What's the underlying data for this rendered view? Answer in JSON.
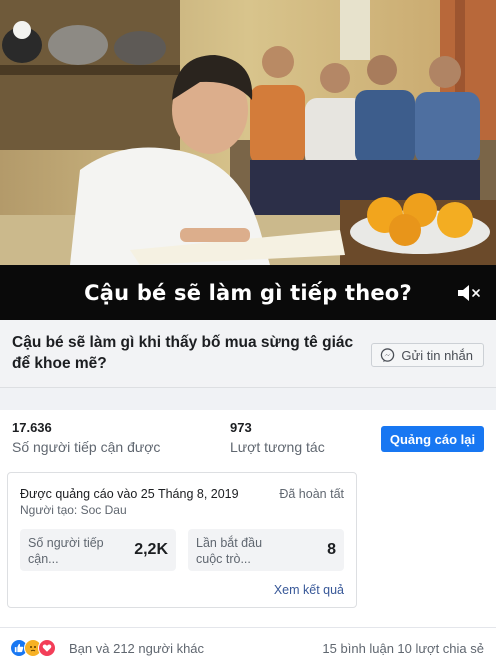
{
  "video": {
    "caption": "Cậu bé sẽ làm gì tiếp theo?",
    "mute_icon": "volume-muted-icon"
  },
  "ad": {
    "headline": "Cậu bé sẽ làm gì khi thấy bố mua sừng tê giác để khoe mẽ?",
    "message_button": "Gửi tin nhắn"
  },
  "stats": {
    "reach_value": "17.636",
    "reach_label": "Số người tiếp cận được",
    "engagement_value": "973",
    "engagement_label": "Lượt tương tác",
    "boost_button": "Quảng cáo lại"
  },
  "card": {
    "promoted": "Được quảng cáo vào 25 Tháng 8, 2019",
    "creator": "Người tạo: Soc Dau",
    "status": "Đã hoàn tất",
    "metric1_label": "Số người tiếp cận...",
    "metric1_value": "2,2K",
    "metric2_label": "Lần bắt đầu cuộc trò...",
    "metric2_value": "8",
    "results_link": "Xem kết quả"
  },
  "footer": {
    "reactions_text": "Bạn và 212 người khác",
    "comments": "15 bình luận",
    "shares": "10 lượt chia sẻ"
  },
  "colors": {
    "accent": "#1877f2",
    "link": "#385898",
    "like": "#1877f2",
    "love": "#f33e58",
    "sad": "#f7b125"
  }
}
